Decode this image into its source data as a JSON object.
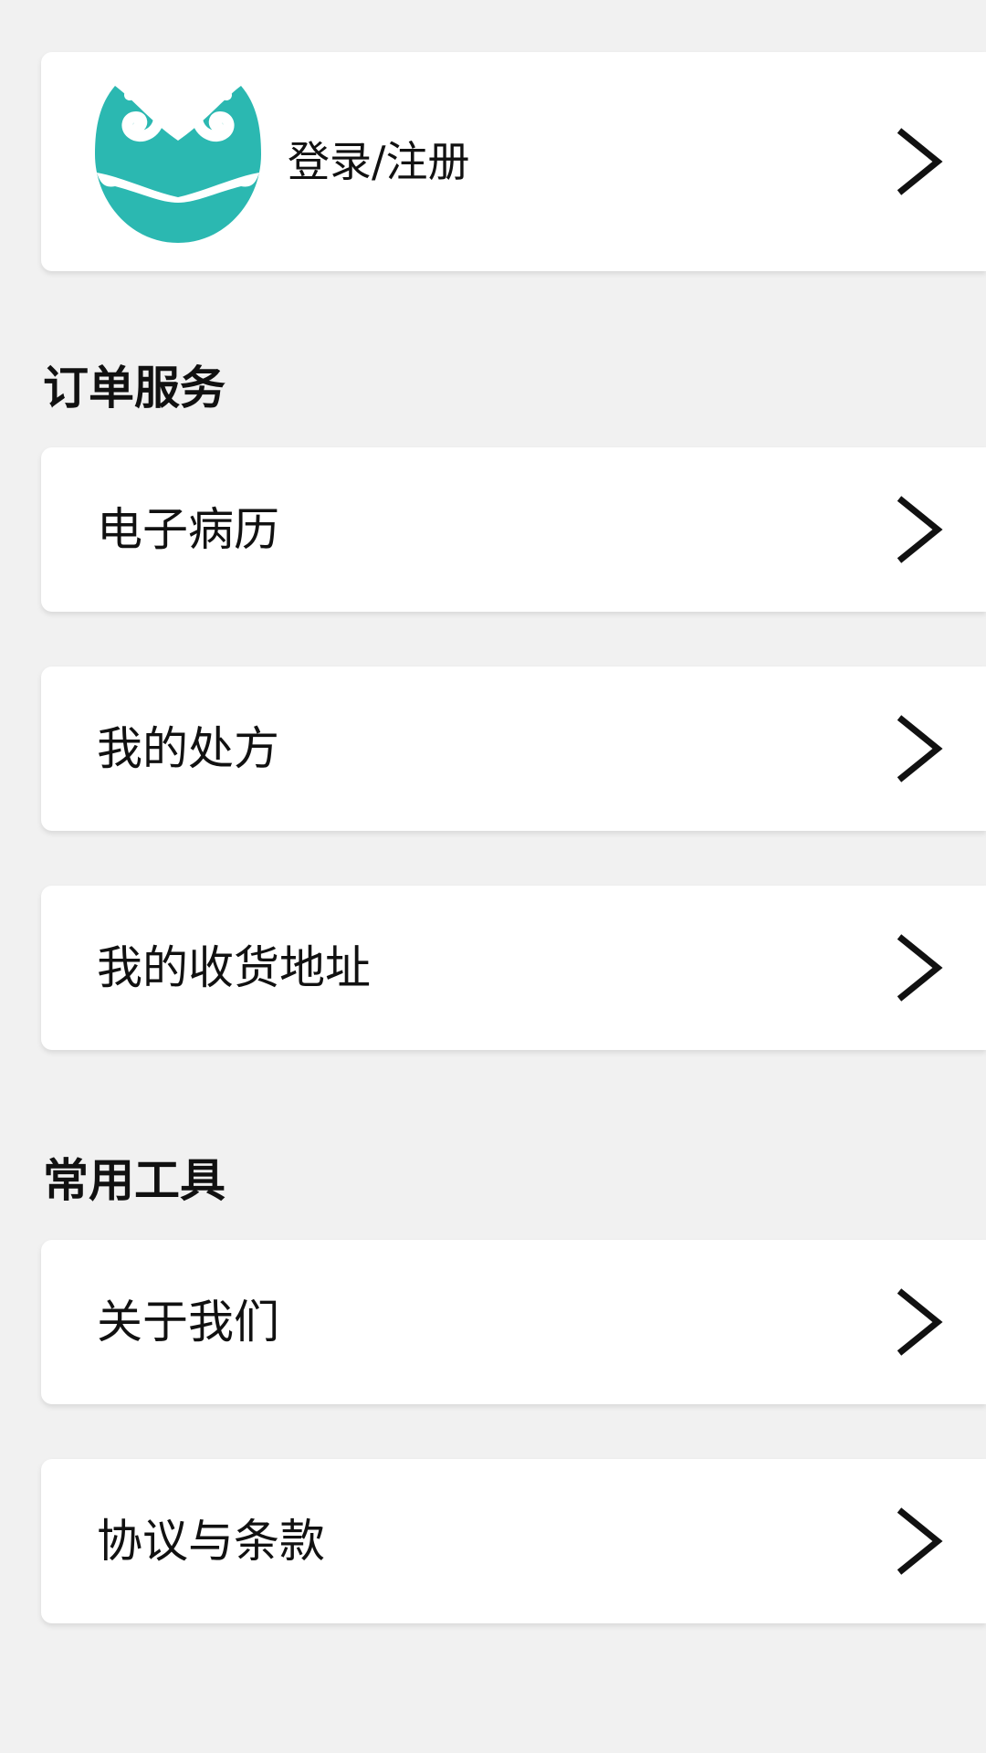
{
  "profile": {
    "login_label": "登录/注册",
    "avatar_color": "#2bb8b1"
  },
  "sections": [
    {
      "title": "订单服务",
      "items": [
        {
          "label": "电子病历"
        },
        {
          "label": "我的处方"
        },
        {
          "label": "我的收货地址"
        }
      ]
    },
    {
      "title": "常用工具",
      "items": [
        {
          "label": "关于我们"
        },
        {
          "label": "协议与条款"
        }
      ]
    }
  ],
  "icons": {
    "chevron": "chevron-right-icon",
    "avatar": "avatar-logo"
  }
}
